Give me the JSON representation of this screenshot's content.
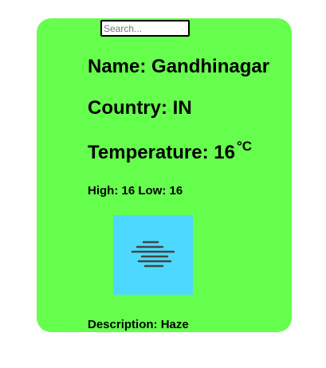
{
  "search": {
    "placeholder": "Search..."
  },
  "weather": {
    "name_label": "Name:",
    "name": "Gandhinagar",
    "country_label": "Country:",
    "country": "IN",
    "temperature_label": "Temperature:",
    "temperature": "16",
    "temperature_unit": "°C",
    "high_label": "High:",
    "high": "16",
    "low_label": "Low:",
    "low": "16",
    "description_label": "Description:",
    "description": "Haze",
    "icon": "haze-icon"
  },
  "colors": {
    "card_background": "#66ff4d",
    "icon_background": "#4dd9ff"
  }
}
